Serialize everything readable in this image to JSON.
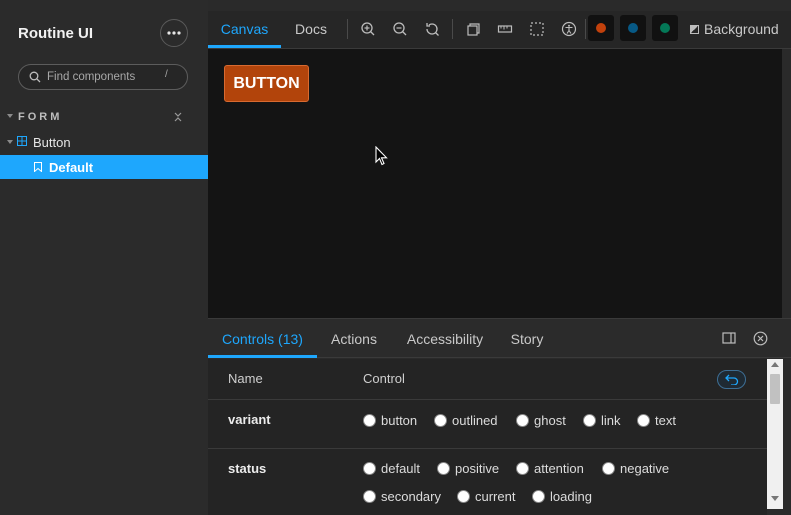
{
  "sidebar": {
    "title": "Routine UI",
    "search": {
      "placeholder": "Find components",
      "shortcut": "/"
    },
    "group": {
      "label": "FORM"
    },
    "items": [
      {
        "label": "Button",
        "icon": "component-icon"
      },
      {
        "label": "Default",
        "icon": "bookmark-icon",
        "selected": true
      }
    ]
  },
  "toolbar": {
    "tabs": [
      {
        "label": "Canvas",
        "active": true
      },
      {
        "label": "Docs",
        "active": false
      }
    ],
    "tools": [
      "zoom-in-icon",
      "zoom-out-icon",
      "zoom-reset-icon",
      "component-outline-icon",
      "ruler-icon",
      "outline-icon",
      "accessibility-icon"
    ],
    "swatches": [
      "#c2410c",
      "#075985",
      "#047857"
    ],
    "background_label": "Background"
  },
  "canvas": {
    "preview_button_label": "BUTTON",
    "preview_button_color": "#b2440b"
  },
  "panel": {
    "tabs": [
      {
        "label": "Controls (13)",
        "active": true
      },
      {
        "label": "Actions",
        "active": false
      },
      {
        "label": "Accessibility",
        "active": false
      },
      {
        "label": "Story",
        "active": false
      }
    ],
    "columns": {
      "name": "Name",
      "control": "Control"
    },
    "rows": [
      {
        "name": "variant",
        "options": [
          "button",
          "outlined",
          "ghost",
          "link",
          "text"
        ]
      },
      {
        "name": "status",
        "options": [
          "default",
          "positive",
          "attention",
          "negative",
          "secondary",
          "current",
          "loading"
        ]
      }
    ]
  },
  "colors": {
    "accent": "#1ea7fd",
    "canvas_bg": "#141414",
    "sidebar_bg": "#2b2b2b"
  }
}
